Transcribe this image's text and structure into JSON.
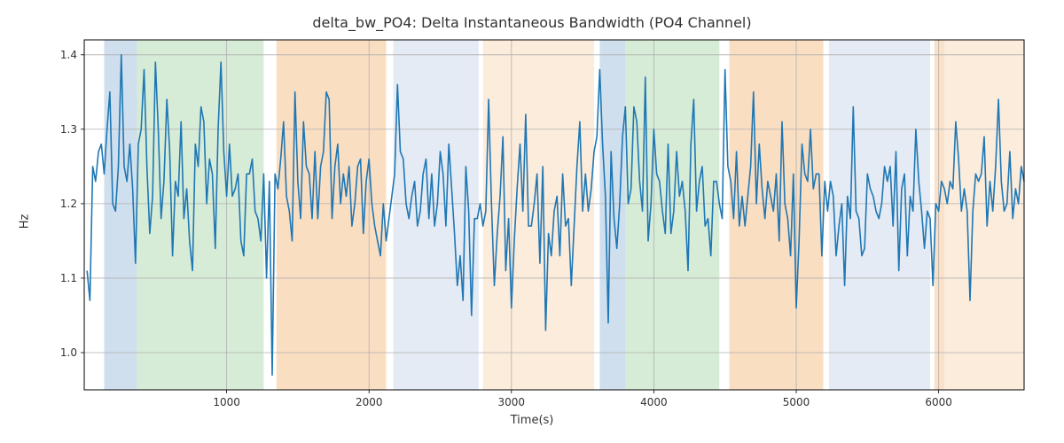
{
  "chart_data": {
    "type": "line",
    "title": "delta_bw_PO4: Delta Instantaneous Bandwidth (PO4 Channel)",
    "xlabel": "Time(s)",
    "ylabel": "Hz",
    "xlim": [
      0,
      6600
    ],
    "ylim": [
      0.95,
      1.42
    ],
    "xticks": [
      1000,
      2000,
      3000,
      4000,
      5000,
      6000
    ],
    "yticks": [
      1.0,
      1.1,
      1.2,
      1.3,
      1.4
    ],
    "line_color": "#1f77b4",
    "bands": [
      {
        "x0": 140,
        "x1": 370,
        "color": "#a7c4e0",
        "alpha": 0.55
      },
      {
        "x0": 370,
        "x1": 1260,
        "color": "#b7dcb7",
        "alpha": 0.55
      },
      {
        "x0": 1350,
        "x1": 2120,
        "color": "#f6c89a",
        "alpha": 0.6
      },
      {
        "x0": 2170,
        "x1": 2770,
        "color": "#c9d8ea",
        "alpha": 0.5
      },
      {
        "x0": 2800,
        "x1": 3580,
        "color": "#f9dcc0",
        "alpha": 0.55
      },
      {
        "x0": 3620,
        "x1": 3800,
        "color": "#a7c4e0",
        "alpha": 0.55
      },
      {
        "x0": 3800,
        "x1": 4460,
        "color": "#b7dcb7",
        "alpha": 0.55
      },
      {
        "x0": 4530,
        "x1": 5190,
        "color": "#f6c89a",
        "alpha": 0.6
      },
      {
        "x0": 5230,
        "x1": 5940,
        "color": "#c9d8ea",
        "alpha": 0.5
      },
      {
        "x0": 5970,
        "x1": 6040,
        "color": "#f6c89a",
        "alpha": 0.55
      },
      {
        "x0": 6040,
        "x1": 6600,
        "color": "#f9dcc0",
        "alpha": 0.55
      }
    ],
    "series": [
      {
        "name": "delta_bw_PO4",
        "x_step": 20,
        "x_start": 20,
        "values": [
          1.11,
          1.07,
          1.25,
          1.23,
          1.27,
          1.28,
          1.24,
          1.3,
          1.35,
          1.2,
          1.19,
          1.25,
          1.4,
          1.25,
          1.23,
          1.28,
          1.22,
          1.12,
          1.28,
          1.3,
          1.38,
          1.25,
          1.16,
          1.21,
          1.39,
          1.3,
          1.18,
          1.23,
          1.34,
          1.27,
          1.13,
          1.23,
          1.21,
          1.31,
          1.18,
          1.22,
          1.15,
          1.11,
          1.28,
          1.25,
          1.33,
          1.31,
          1.2,
          1.26,
          1.24,
          1.14,
          1.3,
          1.39,
          1.27,
          1.21,
          1.28,
          1.21,
          1.22,
          1.24,
          1.15,
          1.13,
          1.24,
          1.24,
          1.26,
          1.19,
          1.18,
          1.15,
          1.24,
          1.1,
          1.23,
          0.97,
          1.24,
          1.22,
          1.26,
          1.31,
          1.21,
          1.19,
          1.15,
          1.35,
          1.23,
          1.18,
          1.31,
          1.25,
          1.24,
          1.18,
          1.27,
          1.18,
          1.25,
          1.27,
          1.35,
          1.34,
          1.18,
          1.25,
          1.28,
          1.2,
          1.24,
          1.21,
          1.25,
          1.17,
          1.2,
          1.25,
          1.26,
          1.16,
          1.23,
          1.26,
          1.2,
          1.17,
          1.15,
          1.13,
          1.2,
          1.15,
          1.18,
          1.21,
          1.24,
          1.36,
          1.27,
          1.26,
          1.2,
          1.18,
          1.21,
          1.23,
          1.17,
          1.19,
          1.24,
          1.26,
          1.18,
          1.24,
          1.17,
          1.2,
          1.27,
          1.24,
          1.17,
          1.28,
          1.22,
          1.16,
          1.09,
          1.13,
          1.07,
          1.25,
          1.19,
          1.05,
          1.18,
          1.18,
          1.2,
          1.17,
          1.19,
          1.34,
          1.2,
          1.09,
          1.16,
          1.21,
          1.29,
          1.11,
          1.18,
          1.06,
          1.15,
          1.22,
          1.28,
          1.19,
          1.32,
          1.17,
          1.17,
          1.2,
          1.24,
          1.12,
          1.25,
          1.03,
          1.16,
          1.13,
          1.19,
          1.21,
          1.13,
          1.24,
          1.17,
          1.18,
          1.09,
          1.17,
          1.25,
          1.31,
          1.19,
          1.24,
          1.19,
          1.22,
          1.27,
          1.29,
          1.38,
          1.28,
          1.21,
          1.04,
          1.27,
          1.18,
          1.14,
          1.2,
          1.29,
          1.33,
          1.2,
          1.22,
          1.33,
          1.31,
          1.23,
          1.19,
          1.37,
          1.15,
          1.2,
          1.3,
          1.24,
          1.23,
          1.19,
          1.16,
          1.28,
          1.16,
          1.19,
          1.27,
          1.21,
          1.23,
          1.19,
          1.11,
          1.28,
          1.34,
          1.19,
          1.23,
          1.25,
          1.17,
          1.18,
          1.13,
          1.23,
          1.23,
          1.2,
          1.18,
          1.38,
          1.25,
          1.23,
          1.18,
          1.27,
          1.17,
          1.21,
          1.17,
          1.21,
          1.25,
          1.35,
          1.2,
          1.28,
          1.22,
          1.18,
          1.23,
          1.21,
          1.19,
          1.24,
          1.15,
          1.31,
          1.2,
          1.18,
          1.13,
          1.24,
          1.06,
          1.15,
          1.28,
          1.24,
          1.23,
          1.3,
          1.22,
          1.24,
          1.24,
          1.13,
          1.23,
          1.19,
          1.23,
          1.21,
          1.13,
          1.17,
          1.2,
          1.09,
          1.21,
          1.18,
          1.33,
          1.19,
          1.18,
          1.13,
          1.14,
          1.24,
          1.22,
          1.21,
          1.19,
          1.18,
          1.2,
          1.25,
          1.23,
          1.25,
          1.17,
          1.27,
          1.11,
          1.22,
          1.24,
          1.13,
          1.21,
          1.19,
          1.3,
          1.23,
          1.19,
          1.14,
          1.19,
          1.18,
          1.09,
          1.2,
          1.19,
          1.23,
          1.22,
          1.2,
          1.23,
          1.22,
          1.31,
          1.26,
          1.19,
          1.22,
          1.19,
          1.07,
          1.19,
          1.24,
          1.23,
          1.24,
          1.29,
          1.17,
          1.23,
          1.19,
          1.25,
          1.34,
          1.23,
          1.19,
          1.2,
          1.27,
          1.18,
          1.22,
          1.2,
          1.25,
          1.23
        ]
      }
    ]
  }
}
